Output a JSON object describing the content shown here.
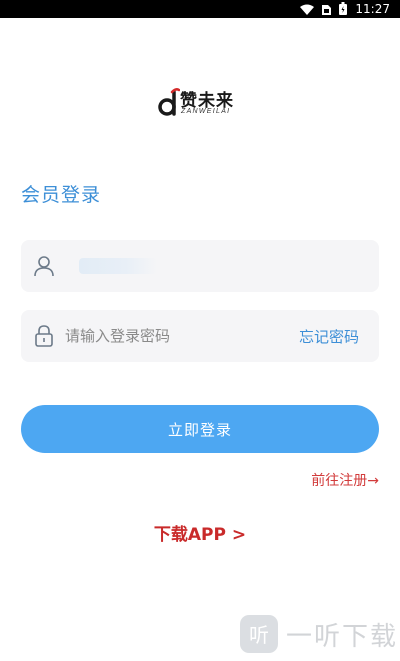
{
  "status_bar": {
    "time": "11:27",
    "icons": [
      "wifi-icon",
      "sim-icon",
      "battery-icon"
    ]
  },
  "logo": {
    "brand": "赞未来",
    "subtitle": "ZANWEILAI"
  },
  "page_title": "会员登录",
  "form": {
    "username_icon": "user-icon",
    "password_icon": "lock-icon",
    "password_placeholder": "请输入登录密码",
    "forgot_password": "忘记密码"
  },
  "login_button": "立即登录",
  "register_link": "前往注册→",
  "download_link": "下载APP >",
  "watermark": {
    "badge_char": "听",
    "text": "一听下载"
  },
  "colors": {
    "accent": "#3d8fd7",
    "button": "#4da7f2",
    "link_red": "#d23b3b",
    "download_red": "#c92a2a"
  }
}
